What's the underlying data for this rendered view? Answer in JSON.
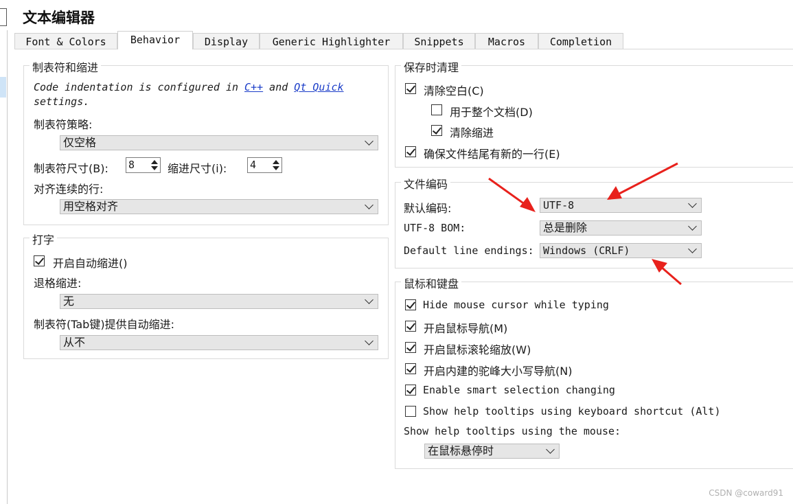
{
  "page_title": "文本编辑器",
  "tabs": [
    {
      "label": "Font & Colors",
      "active": false
    },
    {
      "label": "Behavior",
      "active": true
    },
    {
      "label": "Display",
      "active": false
    },
    {
      "label": "Generic Highlighter",
      "active": false
    },
    {
      "label": "Snippets",
      "active": false
    },
    {
      "label": "Macros",
      "active": false
    },
    {
      "label": "Completion",
      "active": false
    }
  ],
  "tabs_indent": {
    "title": "制表符和缩进",
    "note_prefix": "Code indentation is configured in",
    "note_link1": "C++",
    "note_and": "and",
    "note_link2": "Qt Quick",
    "note_suffix": "settings.",
    "tab_policy_label": "制表符策略:",
    "tab_policy_value": "仅空格",
    "tab_size_label": "制表符尺寸(B):",
    "tab_size_value": "8",
    "indent_size_label": "缩进尺寸(i):",
    "indent_size_value": "4",
    "align_label": "对齐连续的行:",
    "align_value": "用空格对齐"
  },
  "typing": {
    "title": "打字",
    "auto_indent_label": "开启自动缩进()",
    "auto_indent_checked": true,
    "backspace_label": "退格缩进:",
    "backspace_value": "无",
    "tab_indent_label": "制表符(Tab键)提供自动缩进:",
    "tab_indent_value": "从不"
  },
  "cleanup": {
    "title": "保存时清理",
    "items": [
      {
        "label": "清除空白(C)",
        "checked": true
      },
      {
        "label": "用于整个文档(D)",
        "checked": false
      },
      {
        "label": "清除缩进",
        "checked": true
      },
      {
        "label": "确保文件结尾有新的一行(E)",
        "checked": true
      }
    ]
  },
  "encoding": {
    "title": "文件编码",
    "default_label": "默认编码:",
    "default_value": "UTF-8",
    "bom_label": "UTF-8 BOM:",
    "bom_value": "总是删除",
    "line_endings_label": "Default line endings:",
    "line_endings_value": "Windows (CRLF)"
  },
  "mouse": {
    "title": "鼠标和键盘",
    "items": [
      {
        "label": "Hide mouse cursor while typing",
        "checked": true
      },
      {
        "label": "开启鼠标导航(M)",
        "checked": true
      },
      {
        "label": "开启鼠标滚轮缩放(W)",
        "checked": true
      },
      {
        "label": "开启内建的驼峰大小写导航(N)",
        "checked": true
      },
      {
        "label": "Enable smart selection changing",
        "checked": true
      },
      {
        "label": "Show help tooltips using keyboard shortcut (Alt)",
        "checked": false
      }
    ],
    "tooltips_label": "Show help tooltips using the mouse:",
    "tooltips_value": "在鼠标悬停时"
  },
  "colors": {
    "annotation_arrow": "#e8211c",
    "link": "#1a3cc8",
    "combo_bg": "#e6e6e6"
  },
  "watermark": "CSDN @coward91"
}
